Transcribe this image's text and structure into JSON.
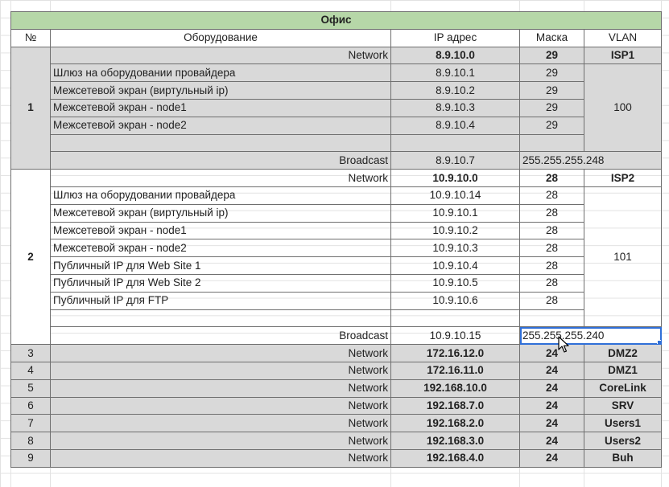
{
  "title": "Офис",
  "headers": {
    "num": "№",
    "equipment": "Оборудование",
    "ip": "IP адрес",
    "mask": "Маска",
    "vlan": "VLAN"
  },
  "blocks": [
    {
      "num": "1",
      "network_label": "Network",
      "network_ip": "8.9.10.0",
      "network_mask": "29",
      "network_vlan": "ISP1",
      "vlan": "100",
      "rows": [
        {
          "equipment": "Шлюз на оборудовании провайдера",
          "ip": "8.9.10.1",
          "mask": "29"
        },
        {
          "equipment": "Межсетевой экран (виртульный ip)",
          "ip": "8.9.10.2",
          "mask": "29"
        },
        {
          "equipment": "Межсетевой экран - node1",
          "ip": "8.9.10.3",
          "mask": "29"
        },
        {
          "equipment": "Межсетевой экран - node2",
          "ip": "8.9.10.4",
          "mask": "29"
        },
        {
          "equipment": "",
          "ip": "",
          "mask": ""
        }
      ],
      "broadcast_label": "Broadcast",
      "broadcast_ip": "8.9.10.7",
      "broadcast_mask": "255.255.255.248"
    },
    {
      "num": "2",
      "network_label": "Network",
      "network_ip": "10.9.10.0",
      "network_mask": "28",
      "network_vlan": "ISP2",
      "vlan": "101",
      "rows": [
        {
          "equipment": "Шлюз на оборудовании провайдера",
          "ip": "10.9.10.14",
          "mask": "28"
        },
        {
          "equipment": "Межсетевой экран (виртульный ip)",
          "ip": "10.9.10.1",
          "mask": "28"
        },
        {
          "equipment": "Межсетевой экран - node1",
          "ip": "10.9.10.2",
          "mask": "28"
        },
        {
          "equipment": "Межсетевой экран - node2",
          "ip": "10.9.10.3",
          "mask": "28"
        },
        {
          "equipment": "Публичный IP для Web Site 1",
          "ip": "10.9.10.4",
          "mask": "28"
        },
        {
          "equipment": "Публичный IP для Web Site 2",
          "ip": "10.9.10.5",
          "mask": "28"
        },
        {
          "equipment": "Публичный IP для FTP",
          "ip": "10.9.10.6",
          "mask": "28"
        },
        {
          "equipment": "",
          "ip": "",
          "mask": ""
        }
      ],
      "broadcast_label": "Broadcast",
      "broadcast_ip": "10.9.10.15",
      "broadcast_mask": "255.255.255.240"
    }
  ],
  "networks": [
    {
      "num": "3",
      "label": "Network",
      "ip": "172.16.12.0",
      "mask": "24",
      "vlan": "DMZ2"
    },
    {
      "num": "4",
      "label": "Network",
      "ip": "172.16.11.0",
      "mask": "24",
      "vlan": "DMZ1"
    },
    {
      "num": "5",
      "label": "Network",
      "ip": "192.168.10.0",
      "mask": "24",
      "vlan": "CoreLink"
    },
    {
      "num": "6",
      "label": "Network",
      "ip": "192.168.7.0",
      "mask": "24",
      "vlan": "SRV"
    },
    {
      "num": "7",
      "label": "Network",
      "ip": "192.168.2.0",
      "mask": "24",
      "vlan": "Users1"
    },
    {
      "num": "8",
      "label": "Network",
      "ip": "192.168.3.0",
      "mask": "24",
      "vlan": "Users2"
    },
    {
      "num": "9",
      "label": "Network",
      "ip": "192.168.4.0",
      "mask": "24",
      "vlan": "Buh"
    }
  ],
  "colors": {
    "title_bg": "#b6d7a8",
    "gray_bg": "#d9d9d9",
    "selection": "#2f6fd8"
  },
  "selected_cell": "block2.broadcast_mask"
}
